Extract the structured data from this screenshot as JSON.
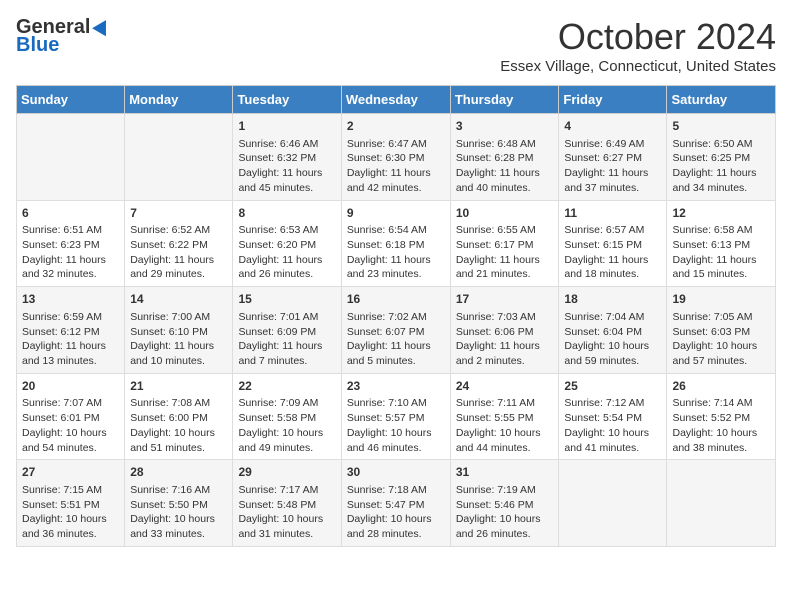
{
  "header": {
    "logo_general": "General",
    "logo_blue": "Blue",
    "month": "October 2024",
    "location": "Essex Village, Connecticut, United States"
  },
  "days_of_week": [
    "Sunday",
    "Monday",
    "Tuesday",
    "Wednesday",
    "Thursday",
    "Friday",
    "Saturday"
  ],
  "weeks": [
    [
      {
        "day": "",
        "sunrise": "",
        "sunset": "",
        "daylight": ""
      },
      {
        "day": "",
        "sunrise": "",
        "sunset": "",
        "daylight": ""
      },
      {
        "day": "1",
        "sunrise": "Sunrise: 6:46 AM",
        "sunset": "Sunset: 6:32 PM",
        "daylight": "Daylight: 11 hours and 45 minutes."
      },
      {
        "day": "2",
        "sunrise": "Sunrise: 6:47 AM",
        "sunset": "Sunset: 6:30 PM",
        "daylight": "Daylight: 11 hours and 42 minutes."
      },
      {
        "day": "3",
        "sunrise": "Sunrise: 6:48 AM",
        "sunset": "Sunset: 6:28 PM",
        "daylight": "Daylight: 11 hours and 40 minutes."
      },
      {
        "day": "4",
        "sunrise": "Sunrise: 6:49 AM",
        "sunset": "Sunset: 6:27 PM",
        "daylight": "Daylight: 11 hours and 37 minutes."
      },
      {
        "day": "5",
        "sunrise": "Sunrise: 6:50 AM",
        "sunset": "Sunset: 6:25 PM",
        "daylight": "Daylight: 11 hours and 34 minutes."
      }
    ],
    [
      {
        "day": "6",
        "sunrise": "Sunrise: 6:51 AM",
        "sunset": "Sunset: 6:23 PM",
        "daylight": "Daylight: 11 hours and 32 minutes."
      },
      {
        "day": "7",
        "sunrise": "Sunrise: 6:52 AM",
        "sunset": "Sunset: 6:22 PM",
        "daylight": "Daylight: 11 hours and 29 minutes."
      },
      {
        "day": "8",
        "sunrise": "Sunrise: 6:53 AM",
        "sunset": "Sunset: 6:20 PM",
        "daylight": "Daylight: 11 hours and 26 minutes."
      },
      {
        "day": "9",
        "sunrise": "Sunrise: 6:54 AM",
        "sunset": "Sunset: 6:18 PM",
        "daylight": "Daylight: 11 hours and 23 minutes."
      },
      {
        "day": "10",
        "sunrise": "Sunrise: 6:55 AM",
        "sunset": "Sunset: 6:17 PM",
        "daylight": "Daylight: 11 hours and 21 minutes."
      },
      {
        "day": "11",
        "sunrise": "Sunrise: 6:57 AM",
        "sunset": "Sunset: 6:15 PM",
        "daylight": "Daylight: 11 hours and 18 minutes."
      },
      {
        "day": "12",
        "sunrise": "Sunrise: 6:58 AM",
        "sunset": "Sunset: 6:13 PM",
        "daylight": "Daylight: 11 hours and 15 minutes."
      }
    ],
    [
      {
        "day": "13",
        "sunrise": "Sunrise: 6:59 AM",
        "sunset": "Sunset: 6:12 PM",
        "daylight": "Daylight: 11 hours and 13 minutes."
      },
      {
        "day": "14",
        "sunrise": "Sunrise: 7:00 AM",
        "sunset": "Sunset: 6:10 PM",
        "daylight": "Daylight: 11 hours and 10 minutes."
      },
      {
        "day": "15",
        "sunrise": "Sunrise: 7:01 AM",
        "sunset": "Sunset: 6:09 PM",
        "daylight": "Daylight: 11 hours and 7 minutes."
      },
      {
        "day": "16",
        "sunrise": "Sunrise: 7:02 AM",
        "sunset": "Sunset: 6:07 PM",
        "daylight": "Daylight: 11 hours and 5 minutes."
      },
      {
        "day": "17",
        "sunrise": "Sunrise: 7:03 AM",
        "sunset": "Sunset: 6:06 PM",
        "daylight": "Daylight: 11 hours and 2 minutes."
      },
      {
        "day": "18",
        "sunrise": "Sunrise: 7:04 AM",
        "sunset": "Sunset: 6:04 PM",
        "daylight": "Daylight: 10 hours and 59 minutes."
      },
      {
        "day": "19",
        "sunrise": "Sunrise: 7:05 AM",
        "sunset": "Sunset: 6:03 PM",
        "daylight": "Daylight: 10 hours and 57 minutes."
      }
    ],
    [
      {
        "day": "20",
        "sunrise": "Sunrise: 7:07 AM",
        "sunset": "Sunset: 6:01 PM",
        "daylight": "Daylight: 10 hours and 54 minutes."
      },
      {
        "day": "21",
        "sunrise": "Sunrise: 7:08 AM",
        "sunset": "Sunset: 6:00 PM",
        "daylight": "Daylight: 10 hours and 51 minutes."
      },
      {
        "day": "22",
        "sunrise": "Sunrise: 7:09 AM",
        "sunset": "Sunset: 5:58 PM",
        "daylight": "Daylight: 10 hours and 49 minutes."
      },
      {
        "day": "23",
        "sunrise": "Sunrise: 7:10 AM",
        "sunset": "Sunset: 5:57 PM",
        "daylight": "Daylight: 10 hours and 46 minutes."
      },
      {
        "day": "24",
        "sunrise": "Sunrise: 7:11 AM",
        "sunset": "Sunset: 5:55 PM",
        "daylight": "Daylight: 10 hours and 44 minutes."
      },
      {
        "day": "25",
        "sunrise": "Sunrise: 7:12 AM",
        "sunset": "Sunset: 5:54 PM",
        "daylight": "Daylight: 10 hours and 41 minutes."
      },
      {
        "day": "26",
        "sunrise": "Sunrise: 7:14 AM",
        "sunset": "Sunset: 5:52 PM",
        "daylight": "Daylight: 10 hours and 38 minutes."
      }
    ],
    [
      {
        "day": "27",
        "sunrise": "Sunrise: 7:15 AM",
        "sunset": "Sunset: 5:51 PM",
        "daylight": "Daylight: 10 hours and 36 minutes."
      },
      {
        "day": "28",
        "sunrise": "Sunrise: 7:16 AM",
        "sunset": "Sunset: 5:50 PM",
        "daylight": "Daylight: 10 hours and 33 minutes."
      },
      {
        "day": "29",
        "sunrise": "Sunrise: 7:17 AM",
        "sunset": "Sunset: 5:48 PM",
        "daylight": "Daylight: 10 hours and 31 minutes."
      },
      {
        "day": "30",
        "sunrise": "Sunrise: 7:18 AM",
        "sunset": "Sunset: 5:47 PM",
        "daylight": "Daylight: 10 hours and 28 minutes."
      },
      {
        "day": "31",
        "sunrise": "Sunrise: 7:19 AM",
        "sunset": "Sunset: 5:46 PM",
        "daylight": "Daylight: 10 hours and 26 minutes."
      },
      {
        "day": "",
        "sunrise": "",
        "sunset": "",
        "daylight": ""
      },
      {
        "day": "",
        "sunrise": "",
        "sunset": "",
        "daylight": ""
      }
    ]
  ]
}
